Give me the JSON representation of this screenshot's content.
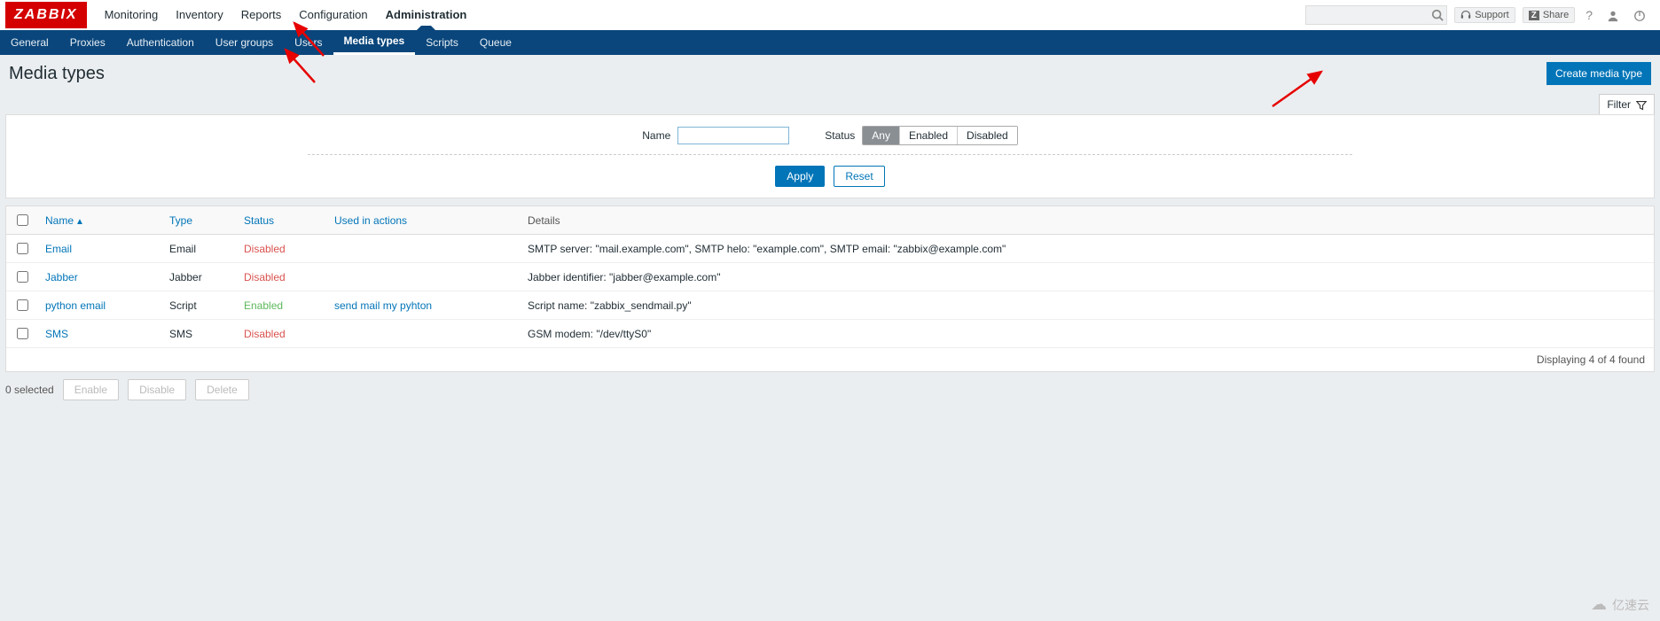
{
  "brand": "ZABBIX",
  "topnav": {
    "items": [
      "Monitoring",
      "Inventory",
      "Reports",
      "Configuration",
      "Administration"
    ],
    "active": 4
  },
  "top_right": {
    "support": "Support",
    "share": "Share"
  },
  "subnav": {
    "items": [
      "General",
      "Proxies",
      "Authentication",
      "User groups",
      "Users",
      "Media types",
      "Scripts",
      "Queue"
    ],
    "active": 5
  },
  "page": {
    "title": "Media types",
    "create_btn": "Create media type",
    "filter_tab": "Filter"
  },
  "filter": {
    "name_label": "Name",
    "name_value": "",
    "status_label": "Status",
    "status_options": [
      "Any",
      "Enabled",
      "Disabled"
    ],
    "apply": "Apply",
    "reset": "Reset"
  },
  "table": {
    "headers": {
      "name": "Name",
      "type": "Type",
      "status": "Status",
      "used_in_actions": "Used in actions",
      "details": "Details"
    },
    "rows": [
      {
        "name": "Email",
        "type": "Email",
        "status": "Disabled",
        "status_class": "disabled",
        "used": "",
        "details": "SMTP server: \"mail.example.com\", SMTP helo: \"example.com\", SMTP email: \"zabbix@example.com\""
      },
      {
        "name": "Jabber",
        "type": "Jabber",
        "status": "Disabled",
        "status_class": "disabled",
        "used": "",
        "details": "Jabber identifier: \"jabber@example.com\""
      },
      {
        "name": "python email",
        "type": "Script",
        "status": "Enabled",
        "status_class": "enabled",
        "used": "send mail my pyhton",
        "details": "Script name: \"zabbix_sendmail.py\""
      },
      {
        "name": "SMS",
        "type": "SMS",
        "status": "Disabled",
        "status_class": "disabled",
        "used": "",
        "details": "GSM modem: \"/dev/ttyS0\""
      }
    ],
    "footer": "Displaying 4 of 4 found"
  },
  "bottom": {
    "selected": "0 selected",
    "enable": "Enable",
    "disable": "Disable",
    "delete": "Delete"
  },
  "watermark": "亿速云"
}
